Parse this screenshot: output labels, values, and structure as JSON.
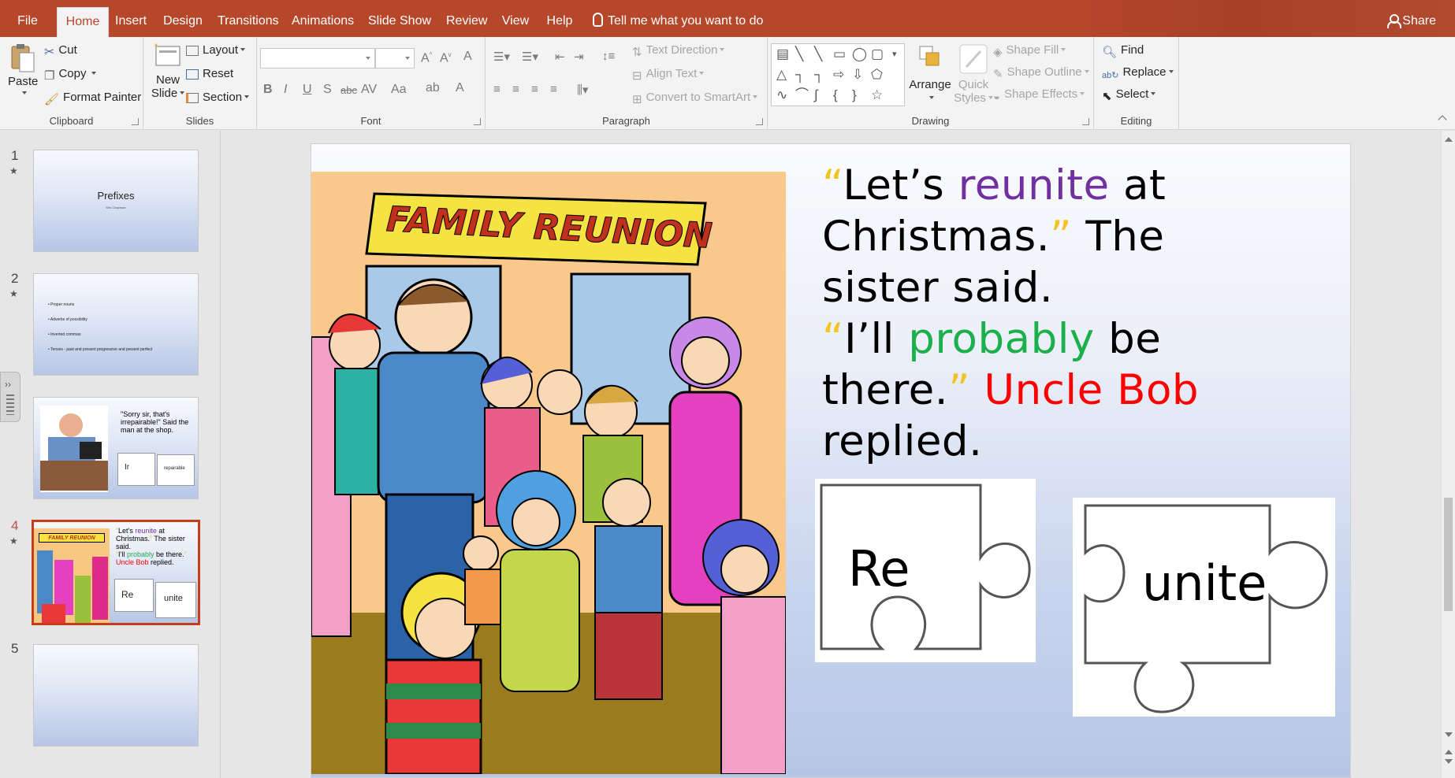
{
  "tabs": [
    "File",
    "Home",
    "Insert",
    "Design",
    "Transitions",
    "Animations",
    "Slide Show",
    "Review",
    "View",
    "Help"
  ],
  "active_tab": "Home",
  "tell_me": "Tell me what you want to do",
  "share": "Share",
  "ribbon": {
    "clipboard": {
      "paste": "Paste",
      "cut": "Cut",
      "copy": "Copy",
      "format_painter": "Format Painter",
      "label": "Clipboard"
    },
    "slides": {
      "new_slide_line1": "New",
      "new_slide_line2": "Slide",
      "layout": "Layout",
      "reset": "Reset",
      "section": "Section",
      "label": "Slides"
    },
    "font": {
      "label": "Font",
      "bold": "B",
      "italic": "I",
      "underline": "U",
      "shadow": "S",
      "strike": "abc",
      "spacing": "AV",
      "case": "Aa"
    },
    "paragraph": {
      "label": "Paragraph",
      "text_direction": "Text Direction",
      "align_text": "Align Text",
      "convert_smartart": "Convert to SmartArt"
    },
    "drawing": {
      "label": "Drawing",
      "arrange": "Arrange",
      "quick_styles_line1": "Quick",
      "quick_styles_line2": "Styles",
      "shape_fill": "Shape Fill",
      "shape_outline": "Shape Outline",
      "shape_effects": "Shape Effects"
    },
    "editing": {
      "label": "Editing",
      "find": "Find",
      "replace": "Replace",
      "select": "Select"
    }
  },
  "thumbnails": [
    {
      "num": "1",
      "title": "Prefixes",
      "subtitle": "Mrs Chapman"
    },
    {
      "num": "2",
      "bullets": [
        "• Proper nouns",
        "• Adverbs of possibility",
        "• Inverted commas",
        "• Tenses - past and present progressive and present perfect"
      ]
    },
    {
      "num": "3",
      "quote": "\"Sorry sir, that's irrepairable!\" Said the man at the shop.",
      "piece_left": "Ir",
      "piece_right": "repairable"
    },
    {
      "num": "4",
      "piece_left": "Re",
      "piece_right": "unite"
    },
    {
      "num": "5"
    }
  ],
  "slide": {
    "banner": "FAMILY REUNION",
    "quote": {
      "q1_open": "“",
      "q1_a": "Let’s ",
      "q1_word": "reunite",
      "q1_b": " at Christmas.",
      "q1_close": "”",
      "q1_tail": " The sister said.",
      "q2_open": "“",
      "q2_a": "I’ll ",
      "q2_word": "probably",
      "q2_b": " be there.",
      "q2_close": "”",
      "q2_name": " Uncle Bob",
      "q2_tail": " replied."
    },
    "piece_left": "Re",
    "piece_right": "unite"
  },
  "colors": {
    "accent": "#b7472a",
    "purple": "#7030a0",
    "green": "#1cb04c",
    "red": "#ff0000",
    "quote_mark": "#f2c325"
  }
}
